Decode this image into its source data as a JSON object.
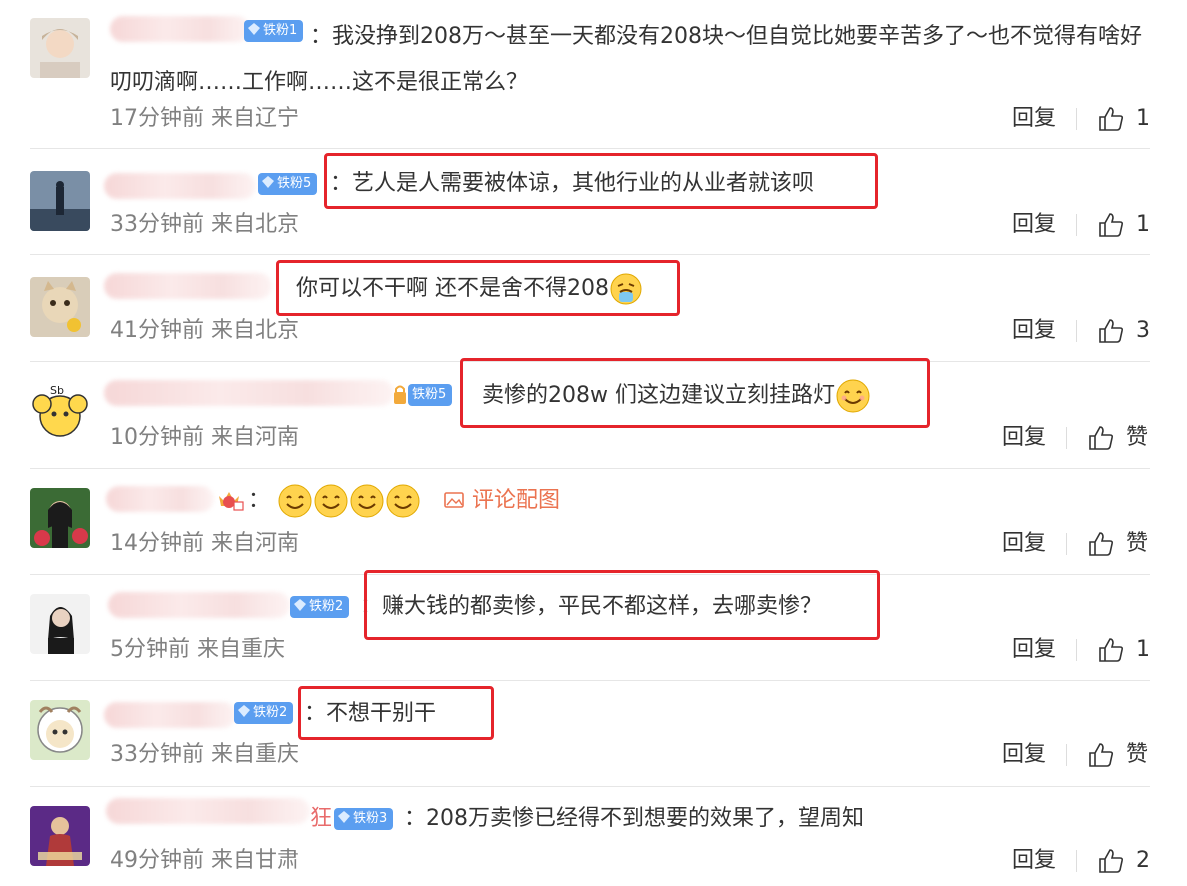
{
  "reply_label": "回复",
  "colors": {
    "accent_red": "#e5242b",
    "badge_blue": "#5b9ef0",
    "meta_gray": "#808080",
    "link_orange": "#eb7350"
  },
  "comments": [
    {
      "badge": "铁粉1",
      "text": "我没挣到208万～甚至一天都没有208块～但自觉比她要辛苦多了～也不觉得有啥好叨叨滴啊……工作啊……这不是很正常么？",
      "time": "17分钟前",
      "location": "来自辽宁",
      "likes": "1"
    },
    {
      "badge": "铁粉5",
      "text": "艺人是人需要被体谅，其他行业的从业者就该呗",
      "time": "33分钟前",
      "location": "来自北京",
      "likes": "1"
    },
    {
      "text": "你可以不干啊 还不是舍不得208",
      "emoji": "crying-face-icon",
      "time": "41分钟前",
      "location": "来自北京",
      "likes": "3"
    },
    {
      "badge": "铁粉5",
      "text": "卖惨的208w 们这边建议立刻挂路灯",
      "emoji": "smile-icon",
      "time": "10分钟前",
      "location": "来自河南",
      "likes": "赞"
    },
    {
      "text": "：",
      "emojis": [
        "smile-icon",
        "smile-icon",
        "smile-icon",
        "smile-icon"
      ],
      "pic_link": "评论配图",
      "time": "14分钟前",
      "location": "来自河南",
      "likes": "赞"
    },
    {
      "badge": "铁粉2",
      "text": "赚大钱的都卖惨，平民不都这样，去哪卖惨？",
      "time": "5分钟前",
      "location": "来自重庆",
      "likes": "1"
    },
    {
      "badge": "铁粉2",
      "text": "不想干别干",
      "time": "33分钟前",
      "location": "来自重庆",
      "likes": "赞"
    },
    {
      "name_tail": "狂",
      "badge": "铁粉3",
      "text": "208万卖惨已经得不到想要的效果了，望周知",
      "time": "49分钟前",
      "location": "来自甘肃",
      "likes": "2"
    }
  ]
}
